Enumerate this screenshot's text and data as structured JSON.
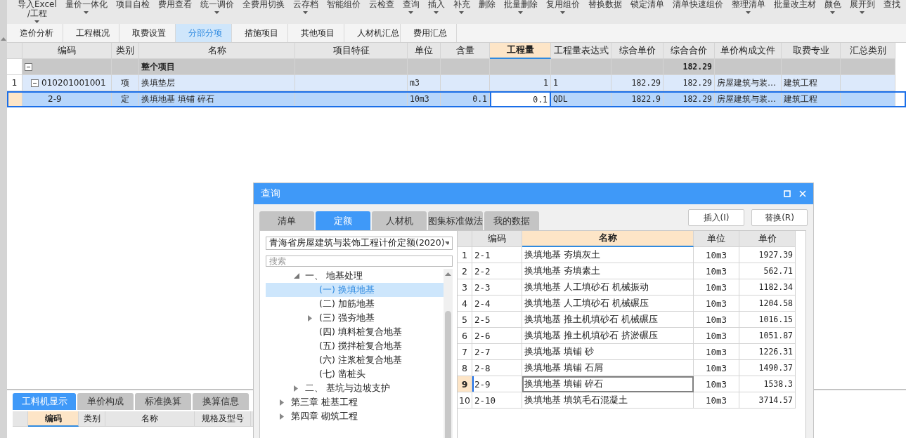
{
  "toolbar": [
    {
      "label": "导入Excel\n/工程",
      "dropdown": true
    },
    {
      "label": "量价一体化",
      "dropdown": true
    },
    {
      "label": "项目自检",
      "dropdown": false
    },
    {
      "label": "费用查看",
      "dropdown": false
    },
    {
      "label": "统一调价",
      "dropdown": true
    },
    {
      "label": "全费用切换",
      "dropdown": false
    },
    {
      "label": "云存档",
      "dropdown": true
    },
    {
      "label": "智能组价",
      "dropdown": false
    },
    {
      "label": "云检查",
      "dropdown": false
    },
    {
      "label": "查询",
      "dropdown": true
    },
    {
      "label": "插入",
      "dropdown": true
    },
    {
      "label": "补充",
      "dropdown": true
    },
    {
      "label": "删除",
      "dropdown": false
    },
    {
      "label": "批量删除",
      "dropdown": true
    },
    {
      "label": "复用组价",
      "dropdown": true
    },
    {
      "label": "替换数据",
      "dropdown": false
    },
    {
      "label": "锁定清单",
      "dropdown": false
    },
    {
      "label": "清单快速组价",
      "dropdown": false
    },
    {
      "label": "整理清单",
      "dropdown": true
    },
    {
      "label": "批量改主材",
      "dropdown": false
    },
    {
      "label": "颜色",
      "dropdown": true
    },
    {
      "label": "展开到",
      "dropdown": true
    },
    {
      "label": "查找",
      "dropdown": false
    }
  ],
  "tabs": [
    {
      "label": "造价分析",
      "selected": false
    },
    {
      "label": "工程概况",
      "selected": false
    },
    {
      "label": "取费设置",
      "selected": false
    },
    {
      "label": "分部分项",
      "selected": true
    },
    {
      "label": "措施项目",
      "selected": false
    },
    {
      "label": "其他项目",
      "selected": false
    },
    {
      "label": "人材机汇总",
      "selected": false
    },
    {
      "label": "费用汇总",
      "selected": false
    }
  ],
  "grid": {
    "columns": [
      {
        "label": "编码",
        "sorted": false
      },
      {
        "label": "类别",
        "sorted": false
      },
      {
        "label": "名称",
        "sorted": false
      },
      {
        "label": "项目特征",
        "sorted": false
      },
      {
        "label": "单位",
        "sorted": false
      },
      {
        "label": "含量",
        "sorted": false
      },
      {
        "label": "工程量",
        "sorted": true
      },
      {
        "label": "工程量表达式",
        "sorted": false
      },
      {
        "label": "综合单价",
        "sorted": false
      },
      {
        "label": "综合合价",
        "sorted": false
      },
      {
        "label": "单价构成文件",
        "sorted": false
      },
      {
        "label": "取费专业",
        "sorted": false
      },
      {
        "label": "汇总类别",
        "sorted": false
      }
    ],
    "rows": [
      {
        "kind": "total",
        "selected": false,
        "expanded": true,
        "name": "整个项目",
        "total": "182.29"
      },
      {
        "kind": "list",
        "selected": false,
        "expanded": true,
        "number": "1",
        "code": "010201001001",
        "type": "项",
        "name": "换填垫层",
        "unit": "m3",
        "qty": "1",
        "expr": "1",
        "unit_price": "182.29",
        "total": "182.29",
        "file": "房屋建筑与装…",
        "fee": "建筑工程"
      },
      {
        "kind": "quota",
        "selected": true,
        "code": "2-9",
        "type": "定",
        "name": "换填地基 填铺 碎石",
        "unit": "10m3",
        "content": "0.1",
        "qty": "0.1",
        "expr": "QDL",
        "unit_price": "1822.9",
        "total": "182.29",
        "file": "房屋建筑与装…",
        "fee": "建筑工程"
      }
    ]
  },
  "bottom_panel": {
    "tabs": [
      {
        "label": "工料机显示",
        "selected": true
      },
      {
        "label": "单价构成",
        "selected": false
      },
      {
        "label": "标准换算",
        "selected": false
      },
      {
        "label": "换算信息",
        "selected": false
      }
    ],
    "columns": [
      {
        "label": "编码",
        "sorted": true
      },
      {
        "label": "类别",
        "sorted": false
      },
      {
        "label": "名称",
        "sorted": false
      },
      {
        "label": "规格及型号",
        "sorted": false
      }
    ]
  },
  "dialog": {
    "title": "查询",
    "tabs": [
      {
        "label": "清单",
        "selected": false
      },
      {
        "label": "定额",
        "selected": true
      },
      {
        "label": "人材机",
        "selected": false
      },
      {
        "label": "图集标准做法",
        "selected": false
      },
      {
        "label": "我的数据",
        "selected": false
      }
    ],
    "buttons": [
      "插入(I)",
      "替换(R)"
    ],
    "library": "青海省房屋建筑与装饰工程计价定额(2020)",
    "search": {
      "placeholder": "搜索"
    },
    "tree": [
      {
        "kind": "section",
        "label": "一、  地基处理",
        "expanded": true,
        "selected": false,
        "children": [
          {
            "kind": "item",
            "label": "(一) 换填地基",
            "selected": true
          },
          {
            "kind": "item",
            "label": "(二) 加筋地基",
            "selected": false
          },
          {
            "kind": "item",
            "label": "(三) 强夯地基",
            "selected": false,
            "expanded": false
          },
          {
            "kind": "item",
            "label": "(四) 填料桩复合地基",
            "selected": false
          },
          {
            "kind": "item",
            "label": "(五) 搅拌桩复合地基",
            "selected": false
          },
          {
            "kind": "item",
            "label": "(六) 注浆桩复合地基",
            "selected": false
          },
          {
            "kind": "item",
            "label": "(七) 凿桩头",
            "selected": false
          }
        ]
      },
      {
        "kind": "section",
        "label": "二、  基坑与边坡支护",
        "expanded": false,
        "selected": false
      },
      {
        "kind": "chapter",
        "label": "第三章 桩基工程",
        "expanded": false,
        "selected": false
      },
      {
        "kind": "chapter",
        "label": "第四章 砌筑工程",
        "expanded": false,
        "selected": false
      }
    ],
    "table": {
      "columns": [
        {
          "label": "编码",
          "sorted": false
        },
        {
          "label": "名称",
          "sorted": true
        },
        {
          "label": "单位",
          "sorted": false
        },
        {
          "label": "单价",
          "sorted": false
        }
      ],
      "rows": [
        {
          "number": "1",
          "code": "2-1",
          "name": "换填地基 夯填灰土",
          "unit": "10m3",
          "price": "1927.39",
          "selected": false
        },
        {
          "number": "2",
          "code": "2-2",
          "name": "换填地基 夯填素土",
          "unit": "10m3",
          "price": "562.71",
          "selected": false
        },
        {
          "number": "3",
          "code": "2-3",
          "name": "换填地基 人工填砂石 机械振动",
          "unit": "10m3",
          "price": "1182.34",
          "selected": false
        },
        {
          "number": "4",
          "code": "2-4",
          "name": "换填地基 人工填砂石 机械碾压",
          "unit": "10m3",
          "price": "1204.58",
          "selected": false
        },
        {
          "number": "5",
          "code": "2-5",
          "name": "换填地基 推土机填砂石 机械碾压",
          "unit": "10m3",
          "price": "1016.15",
          "selected": false
        },
        {
          "number": "6",
          "code": "2-6",
          "name": "换填地基 推土机填砂石 挤淤碾压",
          "unit": "10m3",
          "price": "1051.87",
          "selected": false
        },
        {
          "number": "7",
          "code": "2-7",
          "name": "换填地基 填铺 砂",
          "unit": "10m3",
          "price": "1226.31",
          "selected": false
        },
        {
          "number": "8",
          "code": "2-8",
          "name": "换填地基 填铺 石屑",
          "unit": "10m3",
          "price": "1490.37",
          "selected": false
        },
        {
          "number": "9",
          "code": "2-9",
          "name": "换填地基 填铺 碎石",
          "unit": "10m3",
          "price": "1538.3",
          "selected": true
        },
        {
          "number": "10",
          "code": "2-10",
          "name": "换填地基 填筑毛石混凝土",
          "unit": "10m3",
          "price": "3714.57",
          "selected": false
        }
      ]
    }
  }
}
